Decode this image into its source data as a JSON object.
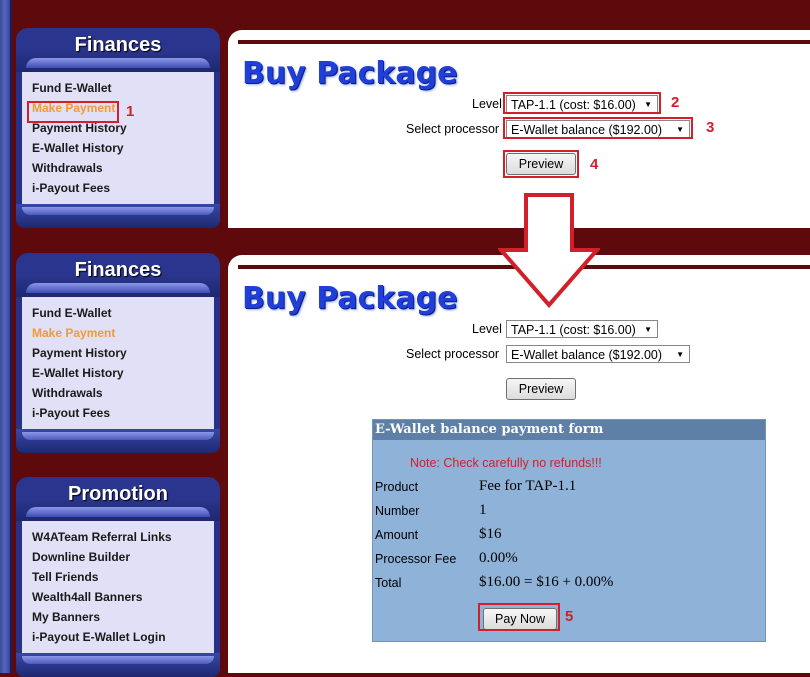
{
  "sidebar": {
    "finances_title": "Finances",
    "finances_items": [
      "Fund E-Wallet",
      "Make Payment",
      "Payment History",
      "E-Wallet History",
      "Withdrawals",
      "i-Payout Fees"
    ],
    "promotion_title": "Promotion",
    "promotion_items": [
      "W4ATeam Referral Links",
      "Downline Builder",
      "Tell Friends",
      "Wealth4all Banners",
      "My Banners",
      "i-Payout E-Wallet Login"
    ]
  },
  "page": {
    "title": "Buy Package",
    "level_label": "Level",
    "level_value": "TAP-1.1 (cost: $16.00)",
    "processor_label": "Select processor",
    "processor_value": "E-Wallet balance ($192.00)",
    "preview_label": "Preview"
  },
  "form": {
    "heading": "E-Wallet balance payment form",
    "note": "Note: Check carefully no refunds!!!",
    "rows": [
      {
        "label": "Product",
        "value": "Fee for TAP-1.1"
      },
      {
        "label": "Number",
        "value": "1"
      },
      {
        "label": "Amount",
        "value": "$16"
      },
      {
        "label": "Processor Fee",
        "value": "0.00%"
      },
      {
        "label": "Total",
        "value": "$16.00 = $16 + 0.00%"
      }
    ],
    "pay_label": "Pay Now"
  },
  "annotations": {
    "n1": "1",
    "n2": "2",
    "n3": "3",
    "n4": "4",
    "n5": "5"
  },
  "colors": {
    "accent": "#d2202a",
    "maroon": "#5e0a0d",
    "active_link": "#f29b34",
    "title_blue": "#1f3fd8"
  }
}
